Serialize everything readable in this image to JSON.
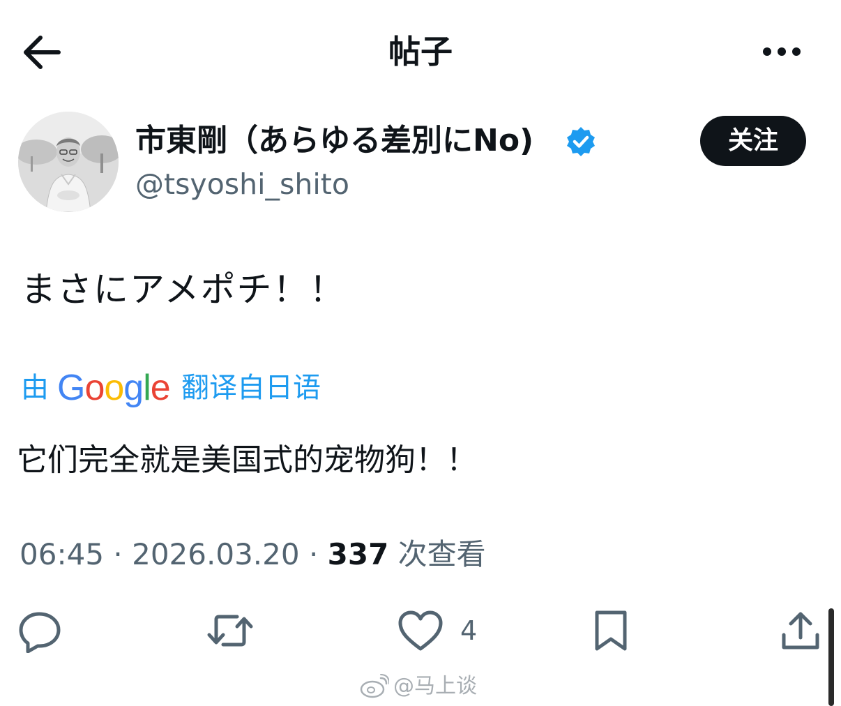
{
  "header": {
    "title": "帖子",
    "back_icon": "arrow-left-icon",
    "more_icon": "more-horizontal-icon"
  },
  "author": {
    "display_name": "市東剛（あらゆる差別にNo)",
    "handle": "@tsyoshi_shito",
    "verified": true,
    "follow_label": "关注"
  },
  "post": {
    "text": "まさにアメポチ！！",
    "translation_by": "由",
    "translation_provider": "Google",
    "translation_link": "翻译自日语",
    "translated_text": "它们完全就是美国式的宠物狗！！"
  },
  "meta": {
    "time": "06:45",
    "separator": " · ",
    "date": "2026.03.20",
    "views_count": "337",
    "views_label": " 次查看"
  },
  "actions": {
    "like_count": "4",
    "icons": [
      "reply-icon",
      "repost-icon",
      "like-icon",
      "bookmark-icon",
      "share-icon"
    ]
  },
  "watermark": {
    "text": "@马上谈"
  },
  "colors": {
    "text": "#0f1419",
    "secondary": "#536471",
    "link": "#1d9bf0",
    "button_bg": "#0f1419",
    "verified": "#1d9bf0"
  }
}
